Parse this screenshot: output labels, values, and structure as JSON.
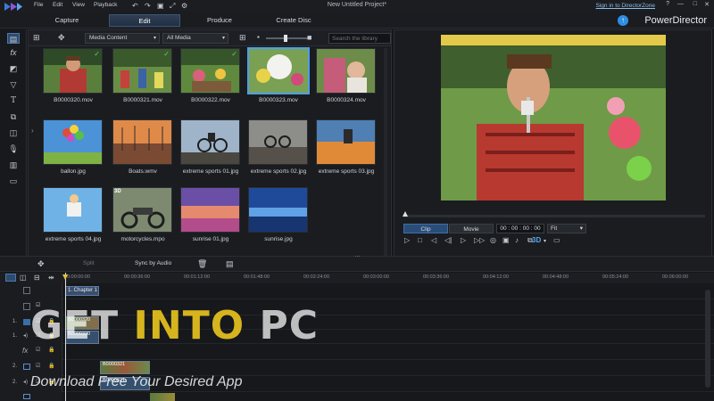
{
  "window": {
    "title": "New Untitled Project*",
    "menu": [
      "File",
      "Edit",
      "View",
      "Playback"
    ],
    "sign_in": "Sign in to DirectorZone",
    "controls": [
      "?",
      "—",
      "□",
      "✕"
    ]
  },
  "tabs": [
    {
      "label": "Capture"
    },
    {
      "label": "Edit"
    },
    {
      "label": "Produce"
    },
    {
      "label": "Create Disc"
    }
  ],
  "brand": "PowerDirector",
  "library_toolbar": {
    "filter_value": "Media Content",
    "type_value": "All Media",
    "search_placeholder": "Search the library"
  },
  "media": [
    {
      "name": "B0000320.mov",
      "checked": true,
      "is3d": false
    },
    {
      "name": "B0000321.mov",
      "checked": true,
      "is3d": false
    },
    {
      "name": "B0000322.mov",
      "checked": true,
      "is3d": false
    },
    {
      "name": "B0000323.mov",
      "checked": false,
      "is3d": false
    },
    {
      "name": "B0000324.mov",
      "checked": false,
      "is3d": false
    },
    {
      "name": "ballon.jpg",
      "checked": false,
      "is3d": false
    },
    {
      "name": "Boats.wmv",
      "checked": false,
      "is3d": false
    },
    {
      "name": "extreme sports 01.jpg",
      "checked": false,
      "is3d": false
    },
    {
      "name": "extreme sports 02.jpg",
      "checked": false,
      "is3d": false
    },
    {
      "name": "extreme sports 03.jpg",
      "checked": false,
      "is3d": false
    },
    {
      "name": "extreme sports 04.jpg",
      "checked": false,
      "is3d": false
    },
    {
      "name": "motorcycles.mpo",
      "checked": false,
      "is3d": true
    },
    {
      "name": "sunrise 01.jpg",
      "checked": false,
      "is3d": false
    },
    {
      "name": "sunrise.jpg",
      "checked": false,
      "is3d": false
    }
  ],
  "tag_3d": "3D",
  "preview": {
    "mode_clip": "Clip",
    "mode_movie": "Movie",
    "timecode": "00 : 00 : 00 : 00",
    "fit": "Fit",
    "badge_3d": "3D"
  },
  "timeline_toolbar": {
    "split": "Split",
    "sync_audio": "Sync by Audio"
  },
  "ruler": [
    "00:00:00:00",
    "00:00:36:00",
    "00:01:12:00",
    "00:01:48:00",
    "00:02:24:00",
    "00:03:00:00",
    "00:03:36:00",
    "00:04:12:00",
    "00:04:48:00",
    "00:05:24:00",
    "00:06:00:00"
  ],
  "timeline": {
    "chapter": "1. Chapter 1",
    "clips": {
      "v1": "B0000320",
      "a1": "B0000320",
      "v2": "B0000321",
      "a2": "B0000321"
    },
    "track_labels": [
      "1.",
      "1.",
      "2.",
      "2."
    ]
  },
  "watermark": {
    "line1_a": "GET",
    "line1_b": "INTO",
    "line1_c": "PC",
    "line2": "Download Free Your Desired App"
  },
  "colors": {
    "accent": "#4d9fe8",
    "panel": "#1a1c20",
    "brand_blue": "#2f8ee4",
    "watermark_yellow": "#e7c21f"
  }
}
